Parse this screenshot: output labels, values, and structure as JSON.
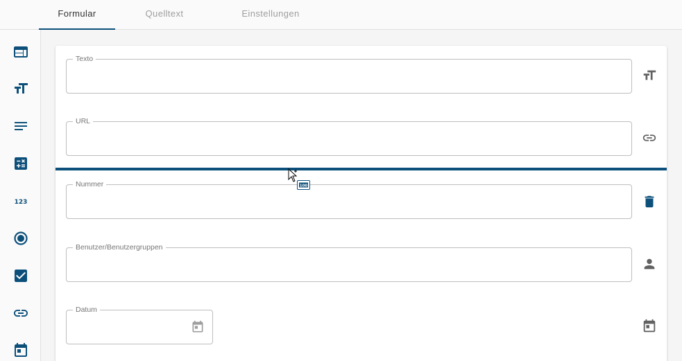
{
  "tabs": [
    {
      "label": "Formular",
      "active": true
    },
    {
      "label": "Quelltext",
      "active": false
    },
    {
      "label": "Einstellungen",
      "active": false
    }
  ],
  "sidebar": {
    "icons": [
      "web-layout-icon",
      "text-size-icon",
      "paragraph-lines-icon",
      "calculator-icon",
      "number-123-icon",
      "radio-button-icon",
      "checkbox-icon",
      "link-icon",
      "calendar-icon"
    ]
  },
  "form": {
    "fields": [
      {
        "label": "Texto",
        "value": "",
        "icon": "text-size-icon"
      },
      {
        "label": "URL",
        "value": "",
        "icon": "link-icon"
      },
      {
        "label": "Nummer",
        "value": "",
        "icon": "delete-icon"
      },
      {
        "label": "Benutzer/Benutzergruppen",
        "value": "",
        "icon": "person-icon"
      },
      {
        "label": "Datum",
        "value": "",
        "icon": "calendar-icon"
      }
    ]
  },
  "colors": {
    "accent": "#0b4f7a",
    "icon_gray": "#616161",
    "border": "#bdbdbd"
  }
}
